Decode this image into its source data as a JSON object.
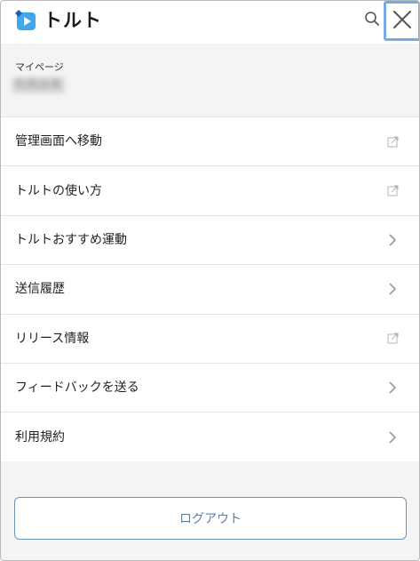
{
  "header": {
    "app_title": "トルト"
  },
  "mypage": {
    "label": "マイページ",
    "user_name": "松尾由美"
  },
  "menu": {
    "items": [
      {
        "label": "管理画面へ移動",
        "icon": "external-link-icon"
      },
      {
        "label": "トルトの使い方",
        "icon": "external-link-icon"
      },
      {
        "label": "トルトおすすめ運動",
        "icon": "chevron-right-icon"
      },
      {
        "label": "送信履歴",
        "icon": "chevron-right-icon"
      },
      {
        "label": "リリース情報",
        "icon": "external-link-icon"
      },
      {
        "label": "フィードバックを送る",
        "icon": "chevron-right-icon"
      },
      {
        "label": "利用規約",
        "icon": "chevron-right-icon"
      }
    ]
  },
  "logout": {
    "label": "ログアウト"
  },
  "colors": {
    "accent": "#5a7fa8",
    "logo_blue": "#3aa0e8",
    "close_highlight": "#7ba9e3"
  }
}
